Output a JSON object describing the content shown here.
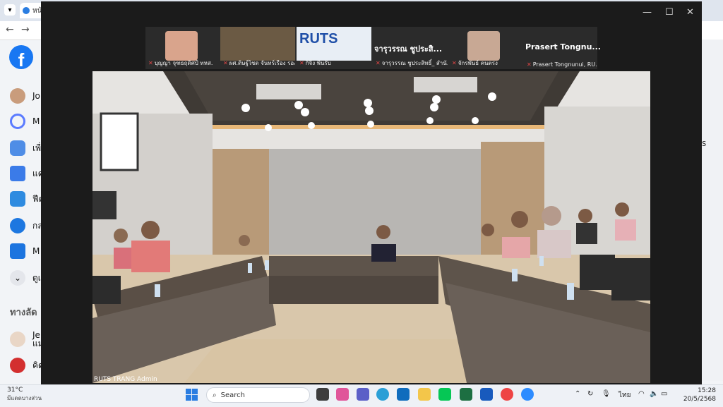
{
  "browser": {
    "tab_title": "หน้",
    "fb_logo": "f"
  },
  "fb": {
    "items": [
      {
        "label": "Jo"
      },
      {
        "label": "M"
      },
      {
        "label": "เพื่"
      },
      {
        "label": "แด"
      },
      {
        "label": "ฟีด"
      },
      {
        "label": "กล"
      },
      {
        "label": "M"
      },
      {
        "label": "ดูเ"
      }
    ],
    "section_title": "ทางลัด",
    "shortcuts": [
      {
        "label": "Je",
        "sub": "แม"
      },
      {
        "label": "คิด"
      }
    ],
    "right_label": "s"
  },
  "meeting": {
    "participants": [
      {
        "name": "บุญญา จุฑธฤดิศป์ ทหส."
      },
      {
        "name": "ผศ.ดิษฐ์ไชด จันทร์เรือง รองอธิ..."
      },
      {
        "name": "กิจิ้ง พินรับ"
      },
      {
        "name": "จารุวรรณ ชูประสิ...",
        "subname": "จารุวรรณ ชูประสิทธิ์_ สำนั..."
      },
      {
        "name": "จักรพันธ์ คนตรง"
      },
      {
        "name": "Prasert Tongnu...",
        "subname": "Prasert Tongnunui, RU..."
      }
    ],
    "ruts_logo": "RUTS",
    "main_label": "RUTS TRANG Admin"
  },
  "taskbar": {
    "weather_temp": "31°C",
    "weather_desc": "มีแดดบางส่วน",
    "search_placeholder": "Search",
    "lang": "ไทย",
    "time": "15:28",
    "date": "20/5/2568"
  },
  "colors": {
    "fb_blue": "#1877f2",
    "teams_bg": "#1b1b1b",
    "mute_red": "#e04545"
  }
}
